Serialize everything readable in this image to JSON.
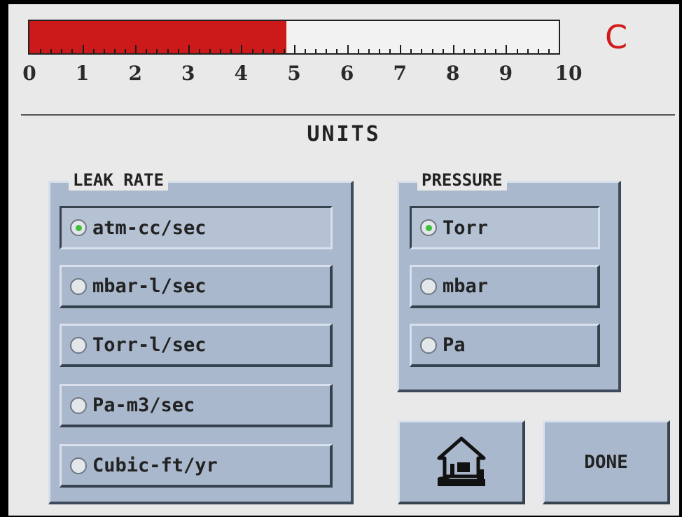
{
  "header": {
    "scale_labels": [
      "0",
      "1",
      "2",
      "3",
      "4",
      "5",
      "6",
      "7",
      "8",
      "9",
      "10"
    ],
    "bar_value": 4.85,
    "bar_max": 10,
    "bar_color": "#cc1a1a",
    "mode_letter": "C",
    "mode_color": "#d11a1a"
  },
  "page": {
    "title": "UNITS"
  },
  "leak_rate": {
    "label": "LEAK RATE",
    "options": [
      {
        "label": "atm-cc/sec",
        "selected": true
      },
      {
        "label": "mbar-l/sec",
        "selected": false
      },
      {
        "label": "Torr-l/sec",
        "selected": false
      },
      {
        "label": "Pa-m3/sec",
        "selected": false
      },
      {
        "label": "Cubic-ft/yr",
        "selected": false
      }
    ]
  },
  "pressure": {
    "label": "PRESSURE",
    "options": [
      {
        "label": "Torr",
        "selected": true
      },
      {
        "label": "mbar",
        "selected": false
      },
      {
        "label": "Pa",
        "selected": false
      }
    ]
  },
  "buttons": {
    "home_icon": "home-icon",
    "done_label": "DONE"
  },
  "colors": {
    "selected_dot": "#3fbf3f",
    "panel": "#a9b8cc"
  }
}
